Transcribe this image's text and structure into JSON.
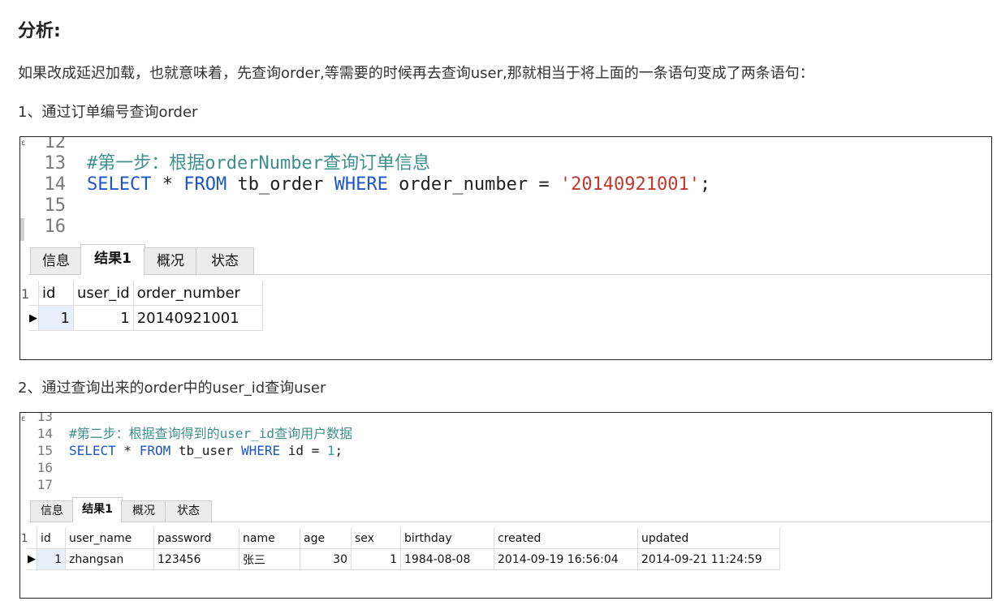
{
  "heading": "分析:",
  "paragraph_intro": "如果改成延迟加载，也就意味着，先查询order,等需要的时候再去查询user,那就相当于将上面的一条语句变成了两条语句：",
  "step1": {
    "caption": "1、通过订单编号查询order",
    "code_lines": [
      {
        "num": "12",
        "parts": []
      },
      {
        "num": "13",
        "parts": [
          {
            "t": "#第一步：根据orderNumber查询订单信息",
            "c": "cm"
          }
        ]
      },
      {
        "num": "14",
        "parts": [
          {
            "t": "SELECT",
            "c": "kw"
          },
          {
            "t": " * ",
            "c": ""
          },
          {
            "t": "FROM",
            "c": "kw"
          },
          {
            "t": " tb_order ",
            "c": ""
          },
          {
            "t": "WHERE",
            "c": "kw"
          },
          {
            "t": " order_number = ",
            "c": ""
          },
          {
            "t": "'20140921001'",
            "c": "str"
          },
          {
            "t": ";",
            "c": ""
          }
        ]
      },
      {
        "num": "15",
        "parts": []
      },
      {
        "num": "16",
        "parts": []
      }
    ],
    "tabs": [
      "信息",
      "结果1",
      "概况",
      "状态"
    ],
    "active_tab": 1,
    "table": {
      "columns": [
        "id",
        "user_id",
        "order_number"
      ],
      "rows": [
        [
          "1",
          "1",
          "20140921001"
        ]
      ]
    }
  },
  "step2": {
    "caption": "2、通过查询出来的order中的user_id查询user",
    "code_lines": [
      {
        "num": "13",
        "parts": []
      },
      {
        "num": "14",
        "parts": [
          {
            "t": "#第二步：根据查询得到的user_id查询用户数据",
            "c": "cm"
          }
        ]
      },
      {
        "num": "15",
        "parts": [
          {
            "t": "SELECT",
            "c": "kw"
          },
          {
            "t": " * ",
            "c": ""
          },
          {
            "t": "FROM",
            "c": "kw"
          },
          {
            "t": " tb_user ",
            "c": ""
          },
          {
            "t": "WHERE",
            "c": "kw"
          },
          {
            "t": " id = ",
            "c": ""
          },
          {
            "t": "1",
            "c": "num"
          },
          {
            "t": ";",
            "c": ""
          }
        ]
      },
      {
        "num": "16",
        "parts": []
      },
      {
        "num": "17",
        "parts": []
      }
    ],
    "tabs": [
      "信息",
      "结果1",
      "概况",
      "状态"
    ],
    "active_tab": 1,
    "table": {
      "columns": [
        "id",
        "user_name",
        "password",
        "name",
        "age",
        "sex",
        "birthday",
        "created",
        "updated"
      ],
      "rows": [
        [
          "1",
          "zhangsan",
          "123456",
          "张三",
          "30",
          "1",
          "1984-08-08",
          "2014-09-19 16:56:04",
          "2014-09-21 11:24:59"
        ]
      ]
    }
  }
}
